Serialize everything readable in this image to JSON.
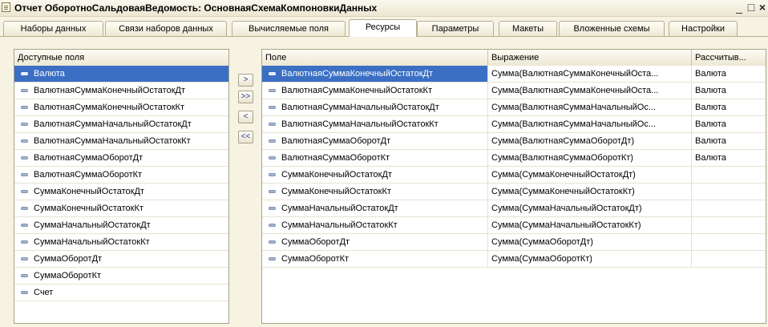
{
  "window": {
    "title": "Отчет ОборотноСальдоваяВедомость: ОсновнаяСхемаКомпоновкиДанных",
    "controls": {
      "minimize": "_",
      "maximize": "□",
      "close": "×"
    }
  },
  "tabs": [
    {
      "label": "Наборы данных"
    },
    {
      "label": "Связи наборов данных"
    },
    {
      "label": "Вычисляемые поля"
    },
    {
      "label": "Ресурсы",
      "active": true
    },
    {
      "label": "Параметры"
    },
    {
      "label": "Макеты"
    },
    {
      "label": "Вложенные схемы"
    },
    {
      "label": "Настройки"
    }
  ],
  "available_fields": {
    "header": "Доступные поля",
    "items": [
      "Валюта",
      "ВалютнаяСуммаКонечныйОстатокДт",
      "ВалютнаяСуммаКонечныйОстатокКт",
      "ВалютнаяСуммаНачальныйОстатокДт",
      "ВалютнаяСуммаНачальныйОстатокКт",
      "ВалютнаяСуммаОборотДт",
      "ВалютнаяСуммаОборотКт",
      "СуммаКонечныйОстатокДт",
      "СуммаКонечныйОстатокКт",
      "СуммаНачальныйОстатокДт",
      "СуммаНачальныйОстатокКт",
      "СуммаОборотДт",
      "СуммаОборотКт",
      "Счет"
    ],
    "selected_index": 0
  },
  "move_buttons": {
    "add": ">",
    "add_all": ">>",
    "remove": "<",
    "remove_all": "<<"
  },
  "resources": {
    "columns": [
      "Поле",
      "Выражение",
      "Рассчитыв..."
    ],
    "selected_index": 0,
    "rows": [
      {
        "field": "ВалютнаяСуммаКонечныйОстатокДт",
        "expression": "Сумма(ВалютнаяСуммаКонечныйОста...",
        "calc_by": "Валюта"
      },
      {
        "field": "ВалютнаяСуммаКонечныйОстатокКт",
        "expression": "Сумма(ВалютнаяСуммаКонечныйОста...",
        "calc_by": "Валюта"
      },
      {
        "field": "ВалютнаяСуммаНачальныйОстатокДт",
        "expression": "Сумма(ВалютнаяСуммаНачальныйОс...",
        "calc_by": "Валюта"
      },
      {
        "field": "ВалютнаяСуммаНачальныйОстатокКт",
        "expression": "Сумма(ВалютнаяСуммаНачальныйОс...",
        "calc_by": "Валюта"
      },
      {
        "field": "ВалютнаяСуммаОборотДт",
        "expression": "Сумма(ВалютнаяСуммаОборотДт)",
        "calc_by": "Валюта"
      },
      {
        "field": "ВалютнаяСуммаОборотКт",
        "expression": "Сумма(ВалютнаяСуммаОборотКт)",
        "calc_by": "Валюта"
      },
      {
        "field": "СуммаКонечныйОстатокДт",
        "expression": "Сумма(СуммаКонечныйОстатокДт)",
        "calc_by": ""
      },
      {
        "field": "СуммаКонечныйОстатокКт",
        "expression": "Сумма(СуммаКонечныйОстатокКт)",
        "calc_by": ""
      },
      {
        "field": "СуммаНачальныйОстатокДт",
        "expression": "Сумма(СуммаНачальныйОстатокДт)",
        "calc_by": ""
      },
      {
        "field": "СуммаНачальныйОстатокКт",
        "expression": "Сумма(СуммаНачальныйОстатокКт)",
        "calc_by": ""
      },
      {
        "field": "СуммаОборотДт",
        "expression": "Сумма(СуммаОборотДт)",
        "calc_by": ""
      },
      {
        "field": "СуммаОборотКт",
        "expression": "Сумма(СуммаОборотКт)",
        "calc_by": ""
      }
    ]
  },
  "colors": {
    "selection": "#3a6fc4",
    "background": "#f6f3e3"
  },
  "icons": {
    "app": "document-icon",
    "field": "field-icon"
  }
}
